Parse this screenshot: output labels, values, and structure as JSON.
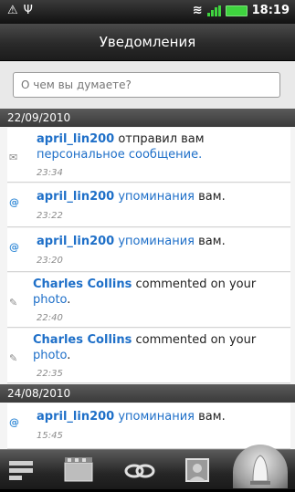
{
  "status_bar": {
    "time": "18:19"
  },
  "header": {
    "title": "Уведомления"
  },
  "search": {
    "placeholder": "О чем вы думаете?"
  },
  "groups": [
    {
      "date": "22/09/2010",
      "items": [
        {
          "icon": "message-icon",
          "name": "april_lin200",
          "text": " отправил вам ",
          "link": "персональное сообщение.",
          "time": "23:34"
        },
        {
          "icon": "mention-icon",
          "name": "april_lin200",
          "link": " упоминания",
          "text": " вам.",
          "time": "23:22"
        },
        {
          "icon": "mention-icon",
          "name": "april_lin200",
          "link": " упоминания",
          "text": " вам.",
          "time": "23:20"
        },
        {
          "icon": "comment-icon",
          "name": "Charles Collins",
          "text": " commented on your ",
          "link": "photo",
          "suffix": ".",
          "time": "22:40"
        },
        {
          "icon": "comment-icon",
          "name": "Charles Collins",
          "text": " commented on your ",
          "link": "photo",
          "suffix": ".",
          "time": "22:35"
        }
      ]
    },
    {
      "date": "24/08/2010",
      "items": [
        {
          "icon": "mention-icon",
          "name": "april_lin200",
          "link": " упоминания",
          "text": " вам.",
          "time": "15:45"
        }
      ]
    }
  ],
  "tabs": [
    "stream",
    "videos",
    "links",
    "photos",
    "notifications"
  ]
}
